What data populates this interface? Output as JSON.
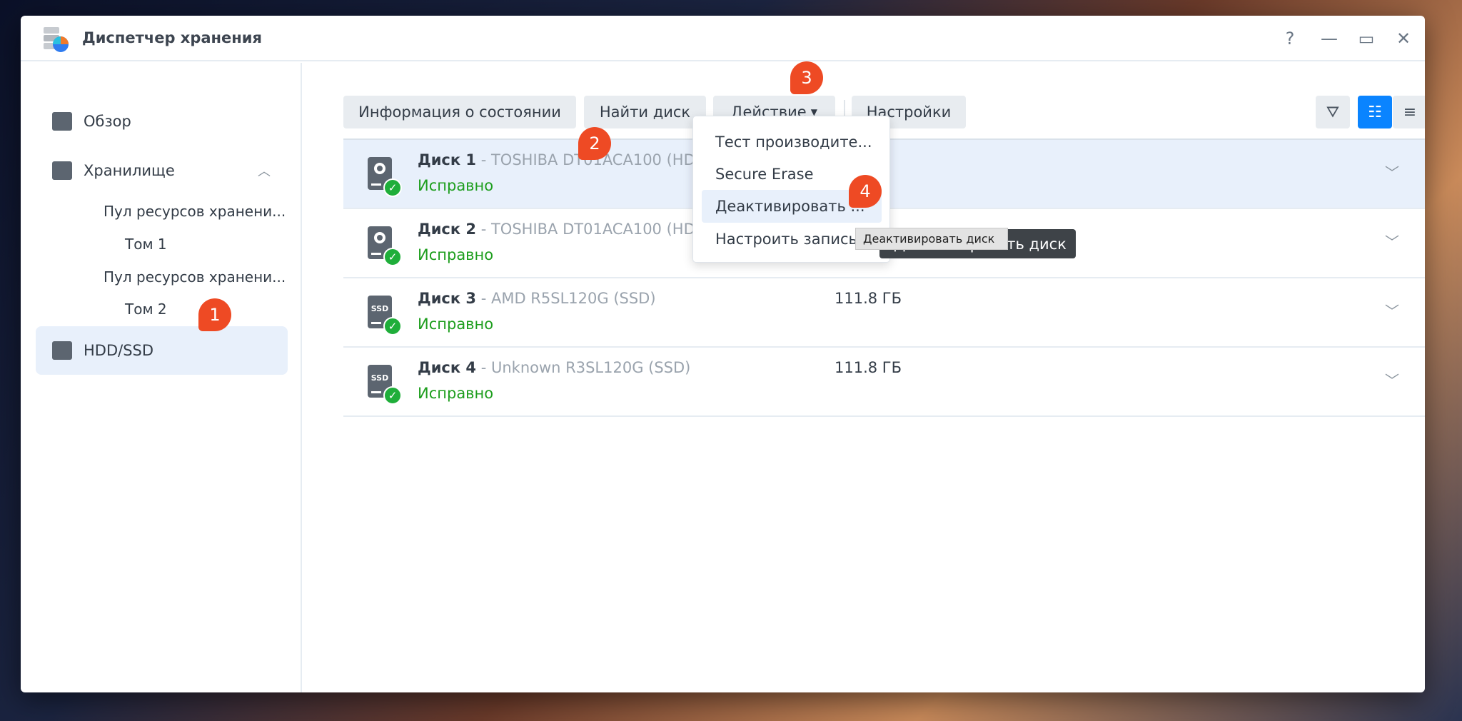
{
  "window": {
    "title": "Диспетчер хранения",
    "controls": {
      "help": "?",
      "minimize": "—",
      "maximize": "▭",
      "close": "✕"
    }
  },
  "sidebar": {
    "items": [
      {
        "label": "Обзор",
        "icon": "overview-icon"
      },
      {
        "label": "Хранилище",
        "icon": "storage-icon",
        "expanded": true
      },
      {
        "label": "Пул ресурсов хранени..."
      },
      {
        "label": "Том 1"
      },
      {
        "label": "Пул ресурсов хранени..."
      },
      {
        "label": "Том 2"
      },
      {
        "label": "HDD/SSD",
        "icon": "hdd-icon",
        "selected": true
      }
    ]
  },
  "toolbar": {
    "status_info": "Информация о состоянии",
    "find_disk": "Найти диск",
    "action": "Действие",
    "settings": "Настройки"
  },
  "disks": [
    {
      "name": "Диск 1",
      "model": " - TOSHIBA DT01ACA100 (HDD)",
      "status": "Исправно",
      "size": "",
      "type": "hdd",
      "selected": true
    },
    {
      "name": "Диск 2",
      "model": " - TOSHIBA DT01ACA100 (HDD)",
      "status": "Исправно",
      "size": "",
      "type": "hdd"
    },
    {
      "name": "Диск 3",
      "model": " - AMD R5SL120G (SSD)",
      "status": "Исправно",
      "size": "111.8 ГБ",
      "type": "ssd"
    },
    {
      "name": "Диск 4",
      "model": " - Unknown R3SL120G (SSD)",
      "status": "Исправно",
      "size": "111.8 ГБ",
      "type": "ssd"
    }
  ],
  "ssd_label": "SSD",
  "action_menu": [
    "Тест производите...",
    "Secure Erase",
    "Деактивировать ...",
    "Настроить запись"
  ],
  "tooltip": "Деактивировать диск",
  "tooltip_dark": "Деактивировать диск",
  "badges": [
    "1",
    "2",
    "3",
    "4"
  ],
  "colors": {
    "accent": "#0a84ff",
    "ok": "#1e9e1e",
    "badge": "#ee4a24",
    "selected_bg": "#e8f0fb"
  }
}
